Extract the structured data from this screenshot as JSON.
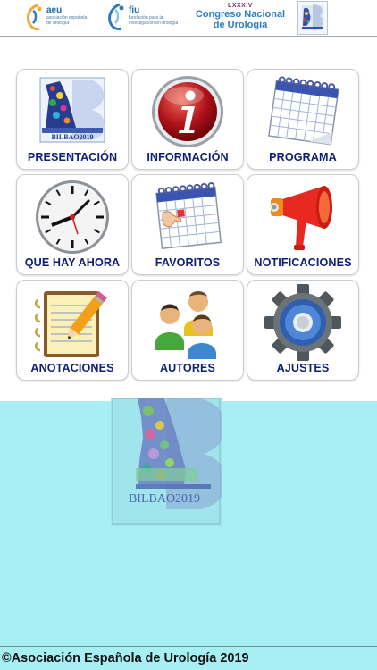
{
  "header": {
    "aeu": {
      "name": "aeu",
      "sub": "asociación española de urología"
    },
    "fiu": {
      "name": "fiu",
      "sub": "fundación para la investigación en urología"
    },
    "congress": {
      "edition": "LXXXIV",
      "line1": "Congreso Nacional",
      "line2": "de Urología"
    }
  },
  "menu": {
    "items": [
      {
        "label": "PRESENTACIÓN",
        "icon": "presentation-poster-icon"
      },
      {
        "label": "INFORMACIÓN",
        "icon": "info-icon"
      },
      {
        "label": "PROGRAMA",
        "icon": "calendar-icon"
      },
      {
        "label": "QUE HAY AHORA",
        "icon": "clock-icon"
      },
      {
        "label": "FAVORITOS",
        "icon": "calendar-favorite-icon"
      },
      {
        "label": "NOTIFICACIONES",
        "icon": "megaphone-icon"
      },
      {
        "label": "ANOTACIONES",
        "icon": "notepad-pencil-icon"
      },
      {
        "label": "AUTORES",
        "icon": "people-icon"
      },
      {
        "label": "AJUSTES",
        "icon": "gear-icon"
      }
    ]
  },
  "poster": {
    "caption": "BILBAO2019"
  },
  "footer": {
    "copyright": "©Asociación Española de Urología 2019"
  },
  "colors": {
    "label": "#0d1f78",
    "cyan_background": "#a8eff4",
    "tile_border": "#c9cdd1"
  }
}
